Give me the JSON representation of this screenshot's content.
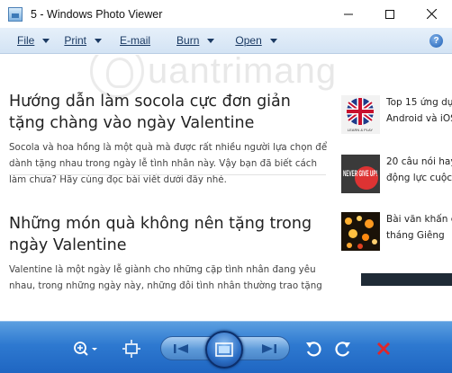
{
  "window": {
    "title": "5 - Windows Photo Viewer",
    "minimize": "minimize",
    "maximize": "maximize",
    "close": "close"
  },
  "menubar": {
    "items": [
      {
        "label": "File"
      },
      {
        "label": "Print"
      },
      {
        "label": "E-mail"
      },
      {
        "label": "Burn"
      },
      {
        "label": "Open"
      }
    ],
    "help_label": "?"
  },
  "photo": {
    "watermark": "uantrimang",
    "articles": [
      {
        "title": "Hướng dẫn làm socola cực đơn giản tặng chàng vào ngày Valentine",
        "body": "Socola và hoa hồng là một quà mà được rất nhiều người lựa chọn để dành tặng nhau trong ngày lễ tình nhân này. Vậy bạn đã biết cách làm chưa? Hãy cùng đọc bài viết dưới đây nhé."
      },
      {
        "title": "Những món quà không nên tặng trong ngày Valentine",
        "body": "Valentine là một ngày lễ giành cho những cặp tình nhân đang yêu nhau, trong những ngày này, những đôi tình nhân thường trao tặng"
      }
    ],
    "sidebar": [
      {
        "line1": "Top 15 ứng dụ",
        "line2": "Android và iOS",
        "thumb_text": "LEARN & PLAY"
      },
      {
        "line1": "20 câu nói hay",
        "line2": "động lực cuộc",
        "thumb_text": "NEVER GIVE UP!"
      },
      {
        "line1": "Bài văn khấn c",
        "line2": "tháng Giêng",
        "thumb_text": ""
      }
    ]
  },
  "toolbar": {
    "zoom": "zoom-icon",
    "actual_size": "actual-size-icon",
    "previous": "previous-icon",
    "slideshow": "slideshow-icon",
    "next": "next-icon",
    "rotate_ccw": "rotate-counterclockwise-icon",
    "rotate_cw": "rotate-clockwise-icon",
    "delete": "delete-icon"
  }
}
